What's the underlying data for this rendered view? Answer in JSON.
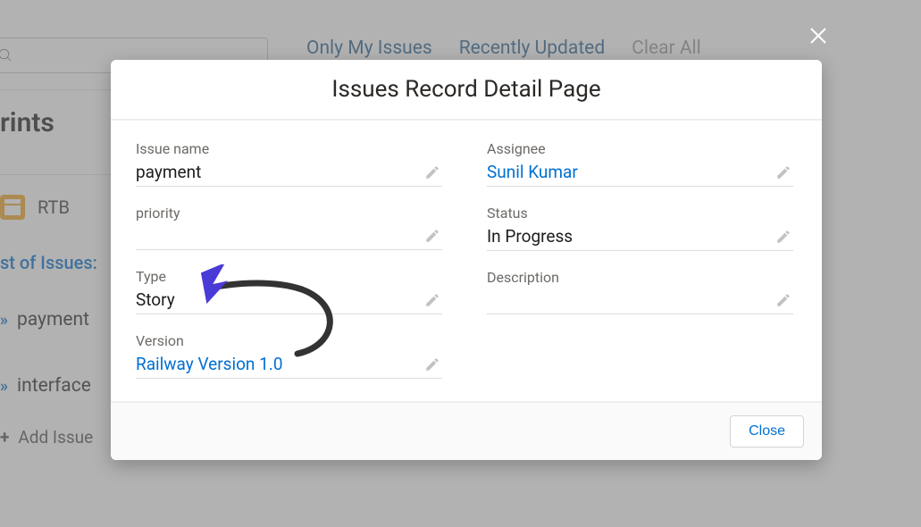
{
  "background": {
    "filters": {
      "only_my": "Only My Issues",
      "recent": "Recently Updated",
      "clear": "Clear All"
    },
    "heading_partial": "rints",
    "rtb_label": "RTB",
    "issues_heading": "st of Issues:",
    "items": {
      "payment": "payment",
      "interface": "interface"
    },
    "add_issue": "Add Issue"
  },
  "close_x_title": "Close",
  "modal": {
    "title": "Issues Record Detail Page",
    "left": {
      "issue_name": {
        "label": "Issue name",
        "value": "payment"
      },
      "priority": {
        "label": "priority",
        "value": ""
      },
      "type": {
        "label": "Type",
        "value": "Story"
      },
      "version": {
        "label": "Version",
        "value": "Railway Version 1.0"
      }
    },
    "right": {
      "assignee": {
        "label": "Assignee",
        "value": "Sunil Kumar"
      },
      "status": {
        "label": "Status",
        "value": "In Progress"
      },
      "description": {
        "label": "Description",
        "value": ""
      }
    },
    "footer": {
      "close": "Close"
    }
  }
}
